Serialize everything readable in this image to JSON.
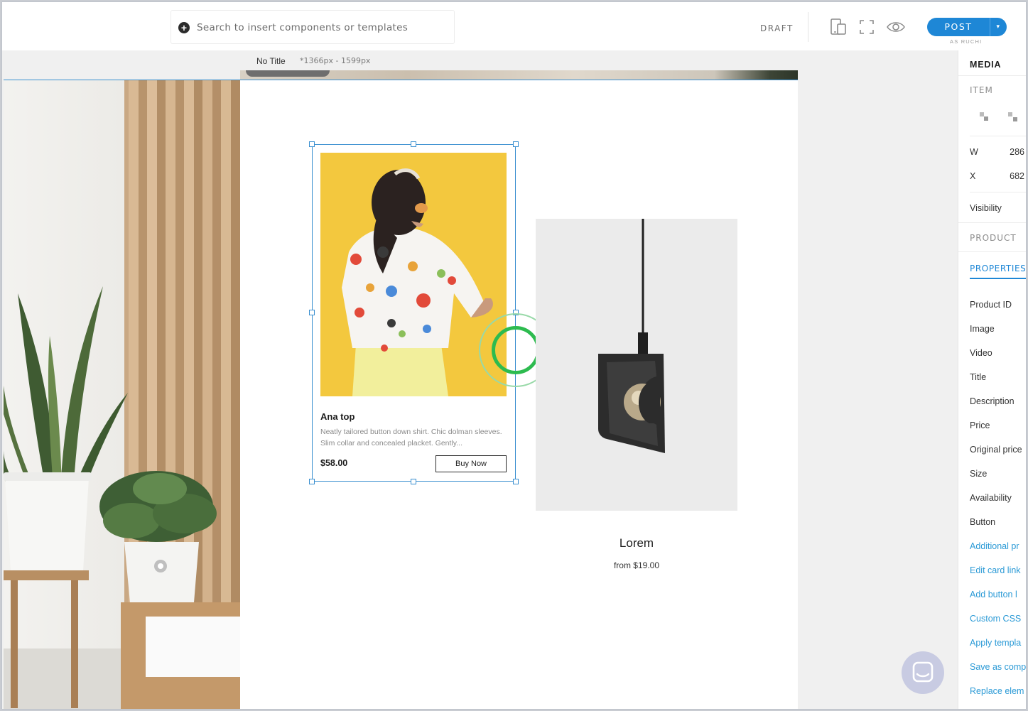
{
  "toolbar": {
    "search_placeholder": "Search to insert components or templates",
    "plus_icon": "+",
    "status": "DRAFT",
    "post_label": "POST",
    "post_caret": "▾",
    "post_subtitle": "AS RUCHI"
  },
  "canvas_info": {
    "page_title": "No Title",
    "page_size": "*1366px - 1599px"
  },
  "products": [
    {
      "title": "Ana top",
      "description": "Neatly tailored button down shirt. Chic dolman sleeves. Slim collar and concealed placket. Gently...",
      "price": "$58.00",
      "button_label": "Buy Now"
    },
    {
      "title": "Lorem",
      "price": "from $19.00"
    }
  ],
  "panel": {
    "header": "MEDIA",
    "item_section": "ITEM",
    "w_label": "W",
    "w_value": "286",
    "x_label": "X",
    "x_value": "682",
    "visibility": "Visibility",
    "product_section": "PRODUCT",
    "properties_tab": "PROPERTIES",
    "property_rows": [
      "Product ID",
      "Image",
      "Video",
      "Title",
      "Description",
      "Price",
      "Original price",
      "Size",
      "Availability",
      "Button"
    ],
    "links": [
      "Additional pr",
      "Edit card link",
      "Add button l",
      "Custom CSS",
      "Apply templa",
      "Save as comp",
      "Replace elem"
    ]
  }
}
